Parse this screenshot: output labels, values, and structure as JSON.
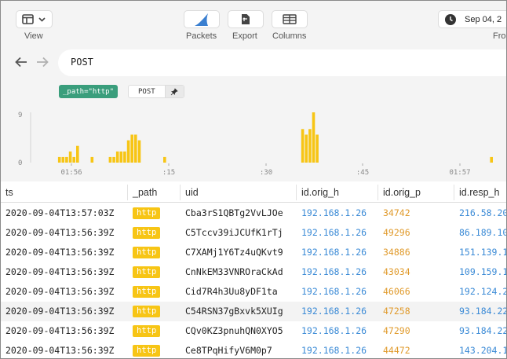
{
  "toolbar": {
    "view_label": "View",
    "packets_label": "Packets",
    "export_label": "Export",
    "columns_label": "Columns",
    "date_text": "Sep 04, 2",
    "from_label": "From"
  },
  "search": {
    "query": "POST",
    "filter_pill": "_path=\"http\"",
    "query_pill": "POST"
  },
  "histogram": {
    "type": "bar",
    "color": "#f7c515",
    "y_ticks": [
      "9",
      "0"
    ],
    "y_max": 9,
    "x_tick_labels": [
      "01:56",
      ":15",
      ":30",
      ":45",
      "01:57"
    ],
    "values": [
      0,
      0,
      0,
      0,
      0,
      0,
      0,
      1,
      1,
      1,
      2,
      1,
      3,
      0,
      0,
      0,
      1,
      0,
      0,
      0,
      0,
      1,
      1,
      2,
      2,
      2,
      4,
      5,
      5,
      4,
      0,
      0,
      0,
      0,
      0,
      0,
      1,
      0,
      0,
      0,
      0,
      0,
      0,
      0,
      0,
      0,
      0,
      0,
      0,
      0,
      0,
      0,
      0,
      0,
      0,
      0,
      0,
      0,
      0,
      0,
      0,
      0,
      0,
      0,
      0,
      0,
      0,
      0,
      0,
      0,
      0,
      0,
      0,
      0,
      6,
      5,
      6,
      9,
      5,
      0,
      0,
      0,
      0,
      0,
      0,
      0,
      0,
      0,
      0,
      0,
      0,
      0,
      0,
      0,
      0,
      0,
      0,
      0,
      0,
      0,
      0,
      0,
      0,
      0,
      0,
      0,
      0,
      0,
      0,
      0,
      0,
      0,
      0,
      0,
      0,
      0,
      0,
      0,
      0,
      0,
      0,
      0,
      0,
      0,
      0,
      0,
      1,
      0,
      0,
      0,
      0
    ]
  },
  "table": {
    "columns": [
      "ts",
      "_path",
      "uid",
      "id.orig_h",
      "id.orig_p",
      "id.resp_h"
    ],
    "rows": [
      {
        "ts": "2020-09-04T13:57:03Z",
        "path": "http",
        "uid": "Cba3rS1QBTg2VvLJOe",
        "orig_h": "192.168.1.26",
        "orig_p": "34742",
        "resp_h": "216.58.20"
      },
      {
        "ts": "2020-09-04T13:56:39Z",
        "path": "http",
        "uid": "C5Tccv39iJCUfK1rTj",
        "orig_h": "192.168.1.26",
        "orig_p": "49296",
        "resp_h": "86.189.10"
      },
      {
        "ts": "2020-09-04T13:56:39Z",
        "path": "http",
        "uid": "C7XAMj1Y6Tz4uQKvt9",
        "orig_h": "192.168.1.26",
        "orig_p": "34886",
        "resp_h": "151.139.1"
      },
      {
        "ts": "2020-09-04T13:56:39Z",
        "path": "http",
        "uid": "CnNkEM33VNROraCkAd",
        "orig_h": "192.168.1.26",
        "orig_p": "43034",
        "resp_h": "109.159.1"
      },
      {
        "ts": "2020-09-04T13:56:39Z",
        "path": "http",
        "uid": "Cid7R4h3Uu8yDF1ta",
        "orig_h": "192.168.1.26",
        "orig_p": "46066",
        "resp_h": "192.124.2"
      },
      {
        "ts": "2020-09-04T13:56:39Z",
        "path": "http",
        "uid": "C54RSN37gBxvk5XUIg",
        "orig_h": "192.168.1.26",
        "orig_p": "47258",
        "resp_h": "93.184.22"
      },
      {
        "ts": "2020-09-04T13:56:39Z",
        "path": "http",
        "uid": "CQv0KZ3pnuhQN0XYO5",
        "orig_h": "192.168.1.26",
        "orig_p": "47290",
        "resp_h": "93.184.22"
      },
      {
        "ts": "2020-09-04T13:56:39Z",
        "path": "http",
        "uid": "Ce8TPqHifyV6M0p7",
        "orig_h": "192.168.1.26",
        "orig_p": "44472",
        "resp_h": "143.204.1"
      }
    ]
  }
}
